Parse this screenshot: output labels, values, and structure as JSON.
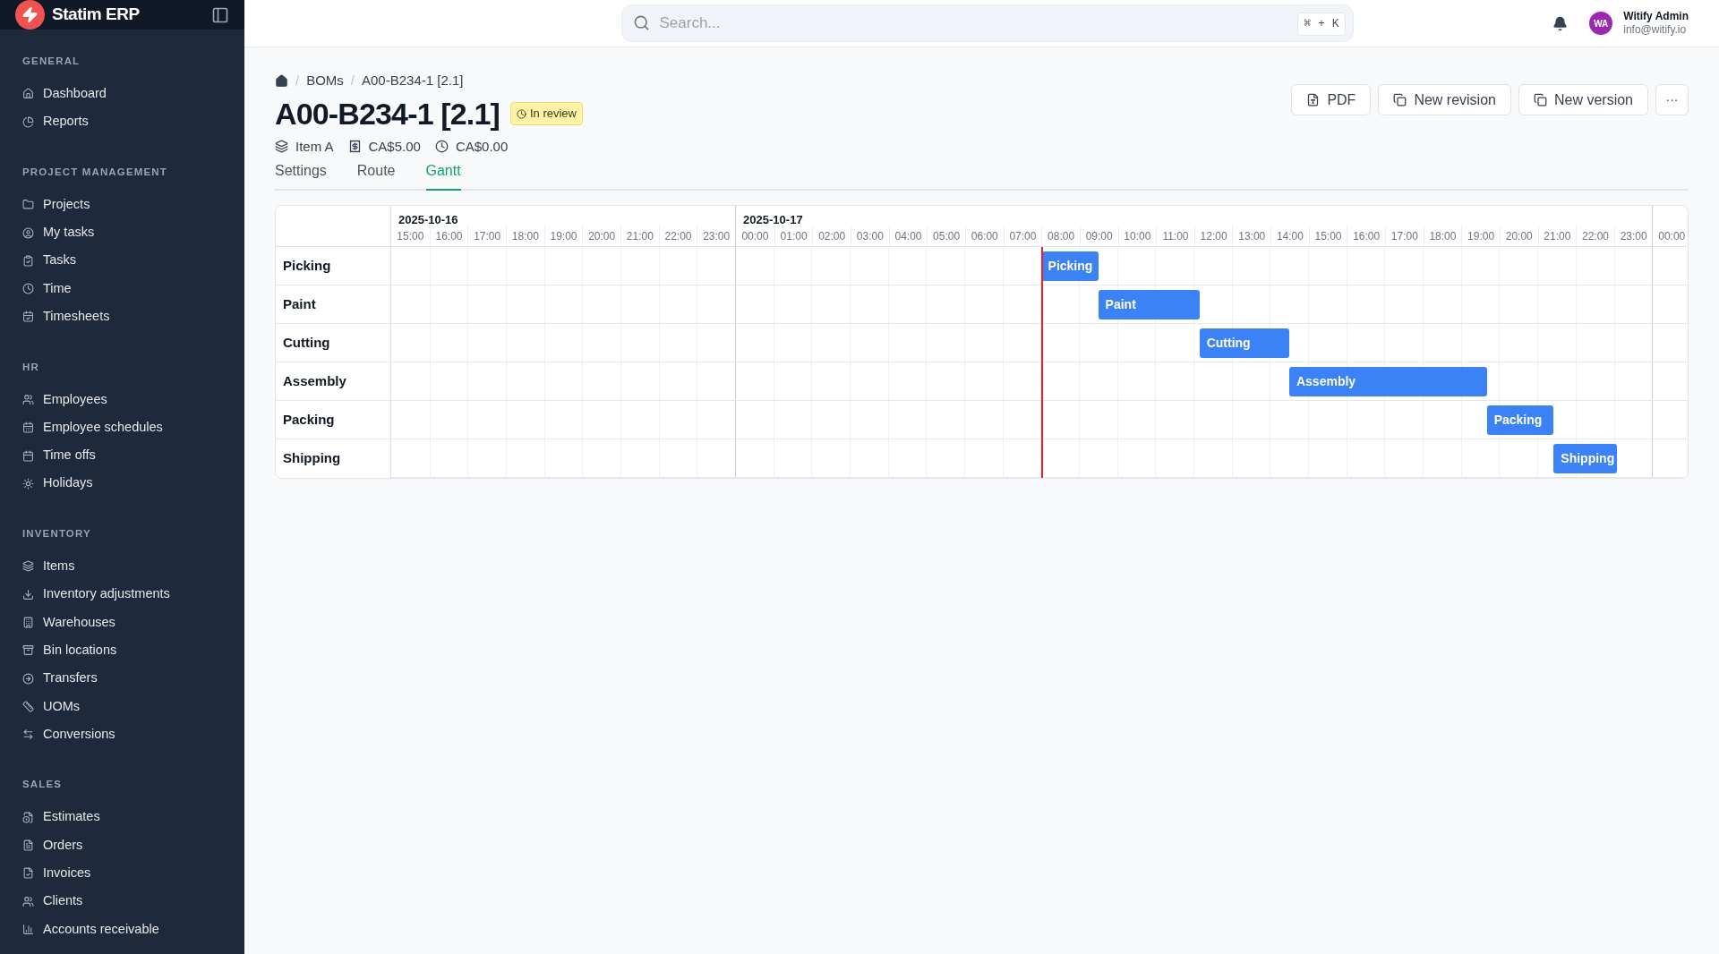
{
  "brand": {
    "name": "Statim ERP"
  },
  "sidebar": {
    "sections": [
      {
        "title": "GENERAL",
        "items": [
          "Dashboard",
          "Reports"
        ]
      },
      {
        "title": "PROJECT MANAGEMENT",
        "items": [
          "Projects",
          "My tasks",
          "Tasks",
          "Time",
          "Timesheets"
        ]
      },
      {
        "title": "HR",
        "items": [
          "Employees",
          "Employee schedules",
          "Time offs",
          "Holidays"
        ]
      },
      {
        "title": "INVENTORY",
        "items": [
          "Items",
          "Inventory adjustments",
          "Warehouses",
          "Bin locations",
          "Transfers",
          "UOMs",
          "Conversions"
        ]
      },
      {
        "title": "SALES",
        "items": [
          "Estimates",
          "Orders",
          "Invoices",
          "Clients",
          "Accounts receivable"
        ]
      }
    ]
  },
  "search": {
    "placeholder": "Search...",
    "shortcut": "⌘ + K"
  },
  "user": {
    "initials": "WA",
    "name": "Witify Admin",
    "email": "info@witify.io"
  },
  "breadcrumbs": [
    {
      "separator": "/",
      "label": "BOMs"
    },
    {
      "separator": "/",
      "label": "A00-B234-1 [2.1]"
    }
  ],
  "title": "A00-B234-1 [2.1]",
  "status": "In review",
  "meta": [
    "Item A",
    "CA$5.00",
    "CA$0.00"
  ],
  "actions": [
    "PDF",
    "New revision",
    "New version"
  ],
  "more": "···",
  "tabs": [
    {
      "label": "Settings",
      "selected": false
    },
    {
      "label": "Route",
      "selected": false
    },
    {
      "label": "Gantt",
      "selected": true
    }
  ],
  "gantt": {
    "days": [
      {
        "day": "2025-10-16",
        "hours": [
          "15:00",
          "16:00",
          "17:00",
          "18:00",
          "19:00",
          "20:00",
          "21:00",
          "22:00",
          "23:00"
        ]
      },
      {
        "day": "2025-10-17",
        "hours": [
          "00:00",
          "01:00",
          "02:00",
          "03:00",
          "04:00",
          "05:00",
          "06:00",
          "07:00",
          "08:00",
          "09:00",
          "10:00",
          "11:00",
          "12:00",
          "13:00",
          "14:00",
          "15:00",
          "16:00",
          "17:00",
          "18:00",
          "19:00",
          "20:00",
          "21:00",
          "22:00",
          "23:00"
        ]
      },
      {
        "hours": [
          "00:00"
        ]
      }
    ],
    "rows": [
      {
        "label": "Picking",
        "bar": "Picking"
      },
      {
        "label": "Paint",
        "bar": "Paint"
      },
      {
        "label": "Cutting",
        "bar": "Cutting"
      },
      {
        "label": "Assembly",
        "bar": "Assembly"
      },
      {
        "label": "Packing",
        "bar": "Packing"
      },
      {
        "label": "Shipping",
        "bar": "Shipping"
      }
    ]
  }
}
